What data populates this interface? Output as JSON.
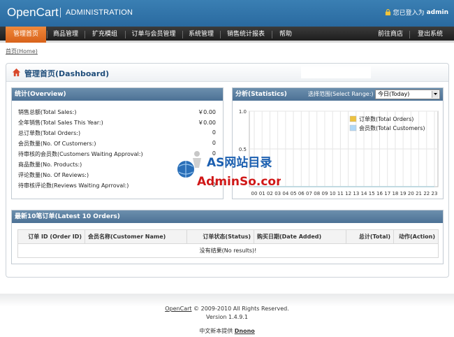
{
  "header": {
    "brand": "OpenCart",
    "title": "ADMINISTRATION",
    "login_prefix": "您已登入为",
    "login_user": "admin"
  },
  "nav": {
    "items": [
      "管理首页",
      "商品管理",
      "扩充模组",
      "订单与会员管理",
      "系统管理",
      "销售统计报表",
      "帮助",
      "前往商店",
      "登出系统"
    ]
  },
  "breadcrumb": "首页(Home)",
  "page": {
    "title": "管理首页(Dashboard)"
  },
  "overview": {
    "title": "统计(Overview)",
    "rows": [
      {
        "label": "销售总额(Total Sales:)",
        "value": "￥0.00"
      },
      {
        "label": "全年销售(Total Sales This Year:)",
        "value": "￥0.00"
      },
      {
        "label": "总订单数(Total Orders:)",
        "value": "0"
      },
      {
        "label": "会员数量(No. Of Customers:)",
        "value": "0"
      },
      {
        "label": "待审核的会员数(Customers Waiting Approval:)",
        "value": "0"
      },
      {
        "label": "商品数量(No. Products:)",
        "value": ""
      },
      {
        "label": "评论数量(No. Of Reviews:)",
        "value": ""
      },
      {
        "label": "待审核评论数(Reviews Waiting Aprroval:)",
        "value": "0"
      }
    ]
  },
  "statistics": {
    "title": "分析(Statistics)",
    "range_label": "选择范围(Select Range:)",
    "range_value": "今日(Today)"
  },
  "chart_data": {
    "type": "line",
    "x": [
      "00",
      "01",
      "02",
      "03",
      "04",
      "05",
      "06",
      "07",
      "08",
      "09",
      "10",
      "11",
      "12",
      "13",
      "14",
      "15",
      "16",
      "17",
      "18",
      "19",
      "20",
      "21",
      "22",
      "23"
    ],
    "series": [
      {
        "name": "订单数(Total Orders)",
        "values": [
          0,
          0,
          0,
          0,
          0,
          0,
          0,
          0,
          0,
          0,
          0,
          0,
          0,
          0,
          0,
          0,
          0,
          0,
          0,
          0,
          0,
          0,
          0,
          0
        ],
        "color": "#edc240"
      },
      {
        "name": "会员数(Total Customers)",
        "values": [
          0,
          0,
          0,
          0,
          0,
          0,
          0,
          0,
          0,
          0,
          0,
          0,
          0,
          0,
          0,
          0,
          0,
          0,
          0,
          0,
          0,
          0,
          0,
          0
        ],
        "color": "#afd8f8"
      }
    ],
    "yticks": [
      "1.0",
      "0.5"
    ],
    "ylim": [
      0,
      1
    ],
    "grid": true,
    "legend": "top-right"
  },
  "orders": {
    "title": "最新10笔订单(Latest 10 Orders)",
    "columns": [
      "订单 ID (Order ID)",
      "会员名称(Customer Name)",
      "订单状态(Status)",
      "购买日期(Date Added)",
      "总计(Total)",
      "动作(Action)"
    ],
    "empty": "没有结果(No results)!"
  },
  "watermark": {
    "line1": "AS网站目录",
    "line2": "AdminSo.com"
  },
  "footer": {
    "brand_link": "OpenCart",
    "copyright": " © 2009-2010 All Rights Reserved.",
    "version": "Version 1.4.9.1",
    "cn_prefix": "中文新本提供",
    "cn_link": "Dnono"
  }
}
